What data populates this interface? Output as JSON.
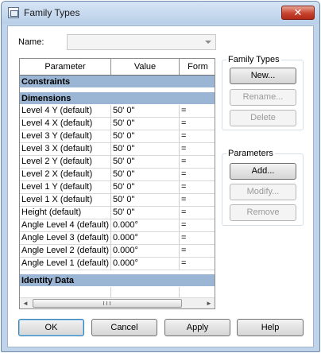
{
  "window": {
    "title": "Family Types",
    "close_glyph": "✕"
  },
  "name_field": {
    "label": "Name:",
    "value": ""
  },
  "grid": {
    "headers": {
      "parameter": "Parameter",
      "value": "Value",
      "formula": "Form"
    },
    "groups": [
      {
        "label": "Constraints",
        "rows": []
      },
      {
        "label": "Dimensions",
        "rows": [
          {
            "parameter": "Level 4 Y (default)",
            "value": "50'  0\"",
            "formula": "="
          },
          {
            "parameter": "Level 4 X (default)",
            "value": "50'  0\"",
            "formula": "="
          },
          {
            "parameter": "Level 3 Y (default)",
            "value": "50'  0\"",
            "formula": "="
          },
          {
            "parameter": "Level 3 X (default)",
            "value": "50'  0\"",
            "formula": "="
          },
          {
            "parameter": "Level 2 Y (default)",
            "value": "50'  0\"",
            "formula": "="
          },
          {
            "parameter": "Level 2 X (default)",
            "value": "50'  0\"",
            "formula": "="
          },
          {
            "parameter": "Level 1 Y (default)",
            "value": "50'  0\"",
            "formula": "="
          },
          {
            "parameter": "Level 1 X (default)",
            "value": "50'  0\"",
            "formula": "="
          },
          {
            "parameter": "Height (default)",
            "value": "50'  0\"",
            "formula": "="
          },
          {
            "parameter": "Angle Level 4 (default)",
            "value": "0.000°",
            "formula": "="
          },
          {
            "parameter": "Angle Level 3 (default)",
            "value": "0.000°",
            "formula": "="
          },
          {
            "parameter": "Angle Level 2 (default)",
            "value": "0.000°",
            "formula": "="
          },
          {
            "parameter": "Angle Level 1 (default)",
            "value": "0.000°",
            "formula": "="
          }
        ]
      },
      {
        "label": "Identity Data",
        "rows": []
      }
    ]
  },
  "family_types": {
    "label": "Family Types",
    "new": "New...",
    "rename": "Rename...",
    "delete": "Delete"
  },
  "parameters": {
    "label": "Parameters",
    "add": "Add...",
    "modify": "Modify...",
    "remove": "Remove"
  },
  "footer": {
    "ok": "OK",
    "cancel": "Cancel",
    "apply": "Apply",
    "help": "Help"
  },
  "icons": {
    "scroll_left": "◄",
    "scroll_right": "►"
  },
  "colors": {
    "group_header": "#9bb5d4",
    "frame": "#bfd3ea",
    "close": "#c7432e"
  }
}
